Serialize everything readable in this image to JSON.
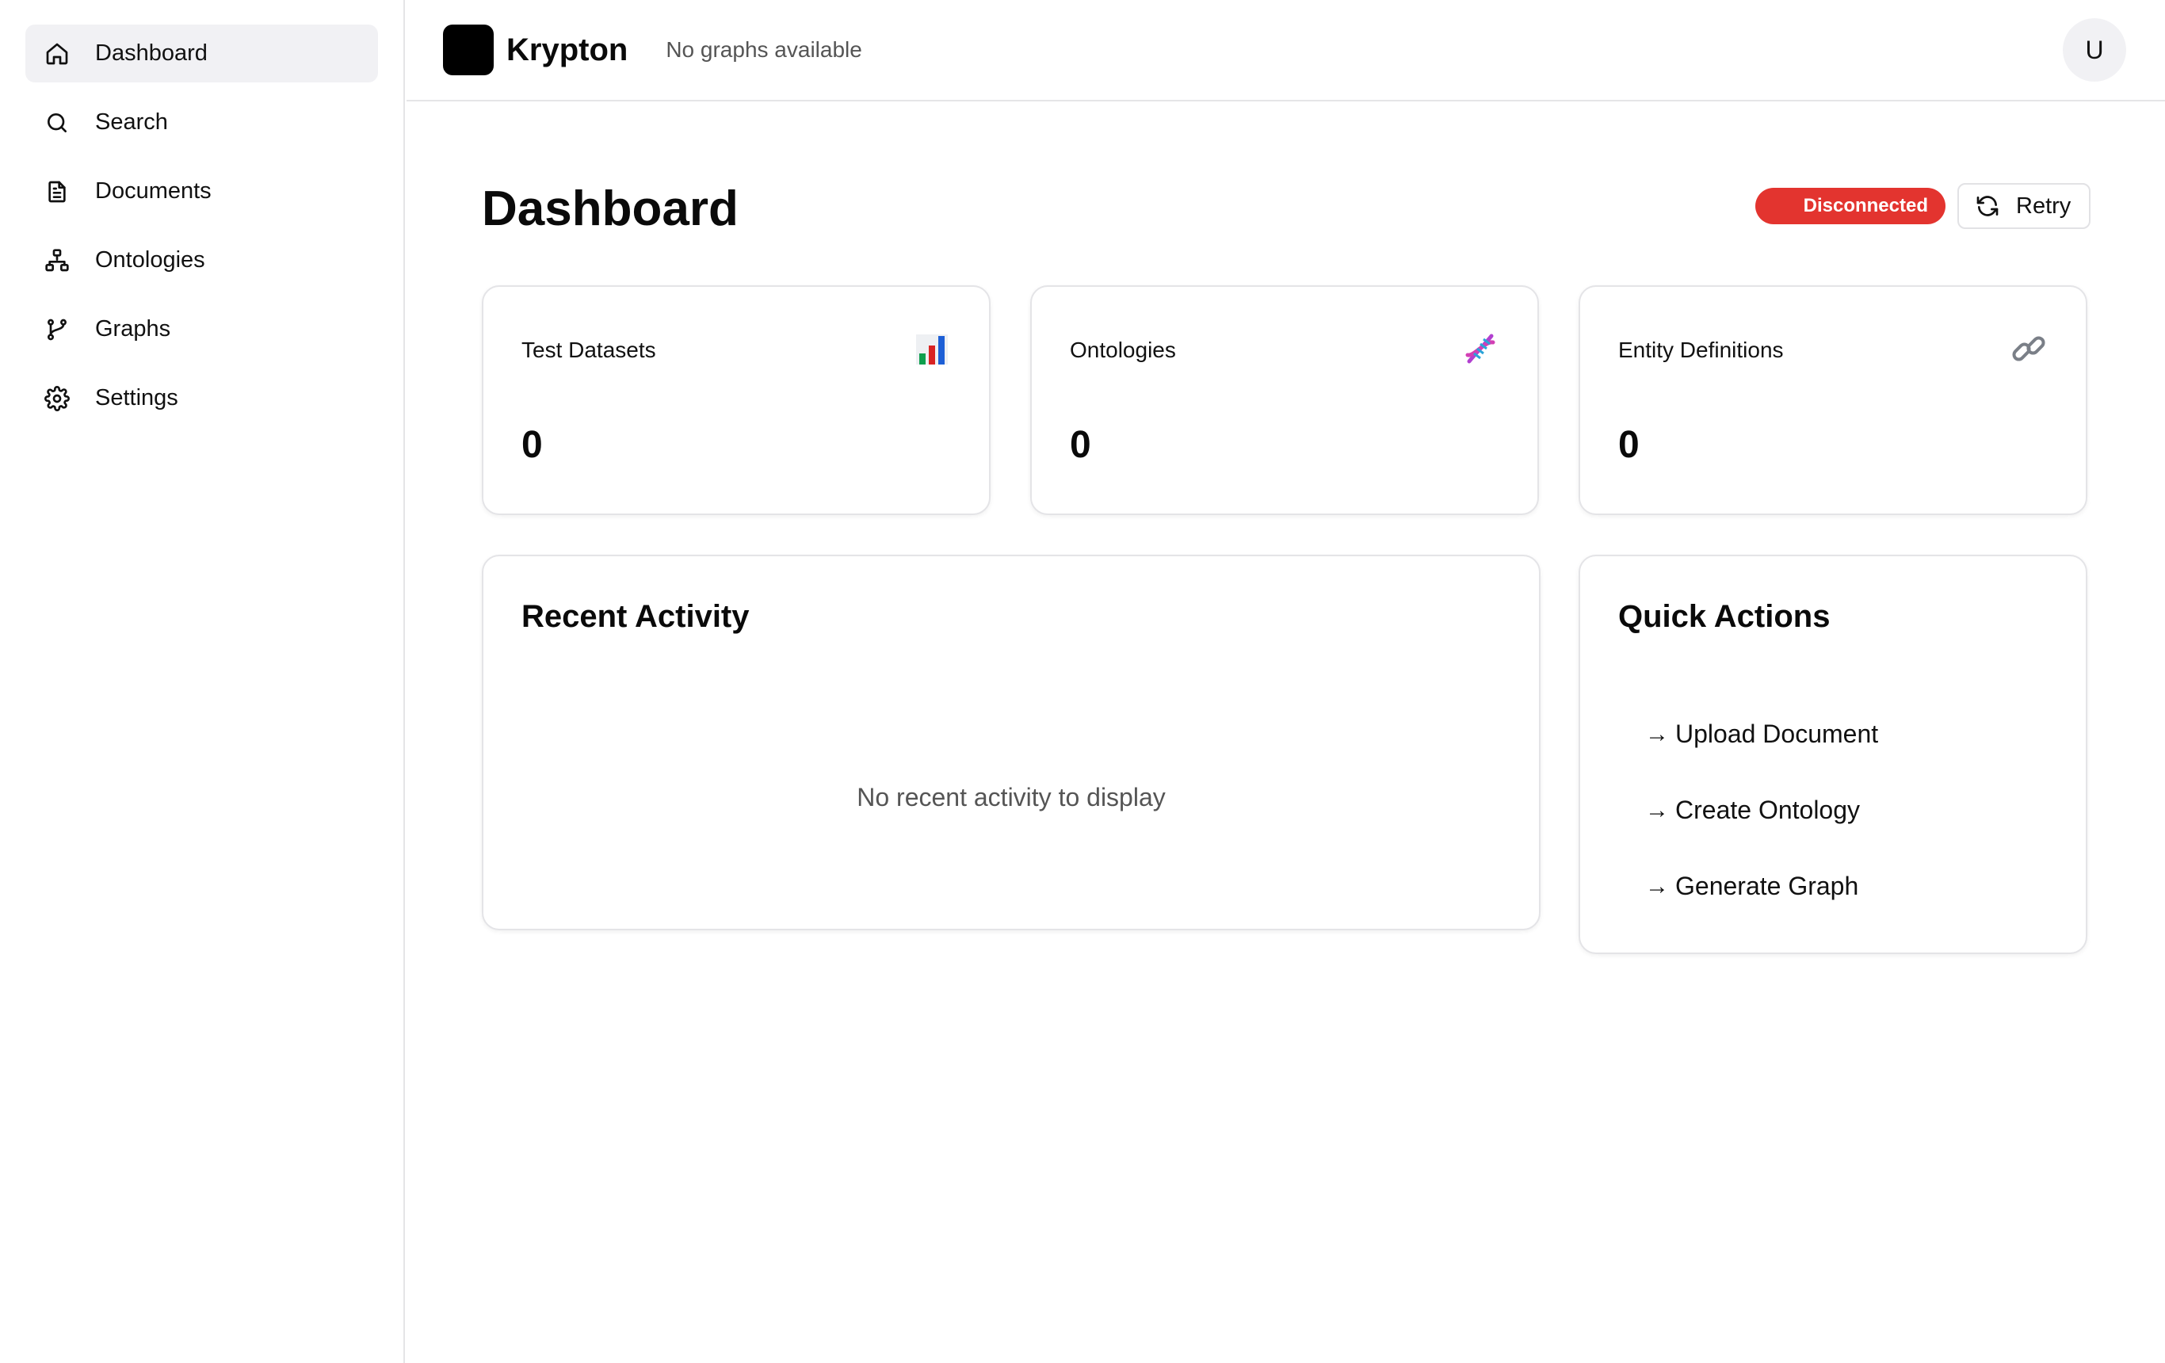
{
  "sidebar": {
    "items": [
      {
        "label": "Dashboard",
        "icon": "home-icon",
        "active": true
      },
      {
        "label": "Search",
        "icon": "search-icon"
      },
      {
        "label": "Documents",
        "icon": "document-icon"
      },
      {
        "label": "Ontologies",
        "icon": "hierarchy-icon"
      },
      {
        "label": "Graphs",
        "icon": "git-branch-icon"
      },
      {
        "label": "Settings",
        "icon": "gear-icon"
      }
    ]
  },
  "header": {
    "brand": "Krypton",
    "graph_status": "No graphs available",
    "avatar_initial": "U"
  },
  "main": {
    "title": "Dashboard",
    "connection_status": "Disconnected",
    "connection_status_color": "#e3342f",
    "retry_label": "Retry",
    "stats": [
      {
        "label": "Test Datasets",
        "value": "0",
        "icon": "bar-chart-icon"
      },
      {
        "label": "Ontologies",
        "value": "0",
        "icon": "dna-icon"
      },
      {
        "label": "Entity Definitions",
        "value": "0",
        "icon": "link-icon"
      }
    ],
    "recent_activity": {
      "title": "Recent Activity",
      "empty_text": "No recent activity to display"
    },
    "quick_actions": {
      "title": "Quick Actions",
      "items": [
        {
          "arrow": "→",
          "label": "Upload Document"
        },
        {
          "arrow": "→",
          "label": "Create Ontology"
        },
        {
          "arrow": "→",
          "label": "Generate Graph"
        }
      ]
    }
  }
}
